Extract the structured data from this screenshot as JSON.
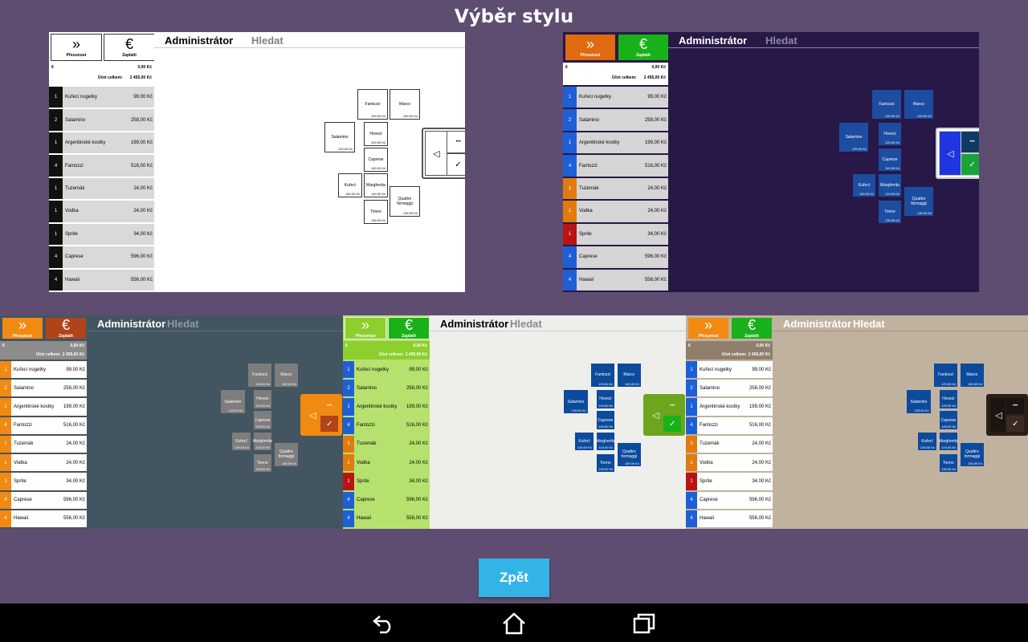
{
  "screen": {
    "title": "Výběr stylu",
    "back_label": "Zpět"
  },
  "pos": {
    "btn_next_label": "Přesunout",
    "btn_pay_label": "Zaplatit",
    "btn_pay_symbol": "€",
    "summary_count": "6",
    "summary_amount": "0,00 Kč",
    "summary_total_label": "Účet celkem:",
    "summary_total": "2 455,00 Kč",
    "user": "Administrátor",
    "search": "Hledat",
    "items": [
      {
        "q": "1",
        "name": "Kuřecí nugetky",
        "price": "99,00 Kč"
      },
      {
        "q": "2",
        "name": "Salamino",
        "price": "258,00 Kč"
      },
      {
        "q": "1",
        "name": "Argentinské kostky",
        "price": "199,00 Kč"
      },
      {
        "q": "4",
        "name": "Fantozzi",
        "price": "516,00 Kč"
      },
      {
        "q": "1",
        "name": "Tuzemák",
        "price": "24,00 Kč"
      },
      {
        "q": "1",
        "name": "Vodka",
        "price": "24,00 Kč"
      },
      {
        "q": "1",
        "name": "Sprite",
        "price": "34,00 Kč"
      },
      {
        "q": "4",
        "name": "Caprese",
        "price": "596,00 Kč"
      },
      {
        "q": "4",
        "name": "Hawaii",
        "price": "556,00 Kč"
      }
    ],
    "products": [
      {
        "name": "Fantozzi",
        "price": "129,00 Kč"
      },
      {
        "name": "Marco",
        "price": "149,00 Kč"
      },
      {
        "name": "Salamino",
        "price": "129,00 Kč"
      },
      {
        "name": "Hovezi",
        "price": "129,00 Kč"
      },
      {
        "name": "Caprese",
        "price": "149,00 Kč"
      },
      {
        "name": "Kuřecí",
        "price": "149,00 Kč"
      },
      {
        "name": "Margherita",
        "price": "119,00 Kč"
      },
      {
        "name": "Tonno",
        "price": "139,00 Kč"
      },
      {
        "name": "Quattro formaggi",
        "price": "139,00 Kč"
      }
    ],
    "ctrl": {
      "back_symbol": "◁",
      "more_symbol": "•••",
      "ok_symbol": "✓"
    }
  },
  "themes": [
    {
      "name": "white",
      "bg": "#ffffff",
      "left_bg": "#ffffff",
      "row_bg": "#d9d9d9",
      "row_text": "#000000",
      "qty_colors": [
        "#111111",
        "#111111",
        "#111111",
        "#111111",
        "#111111",
        "#111111",
        "#111111",
        "#111111",
        "#111111"
      ],
      "qty_text": "#ffffff",
      "btn_next_bg": "#ffffff",
      "btn_pay_bg": "#ffffff",
      "btn_border": "#333333",
      "btn_text": "#000000",
      "sum_bg": "#ffffff",
      "sum_text": "#000000",
      "hdr_text": "#000000",
      "search_text": "#808080",
      "hdr_line": "#cccccc",
      "prod_bg": "#ffffff",
      "prod_text": "#000000",
      "prod_border": "#333333",
      "ctrl_bg": "#ffffff",
      "ctrl_border": "#555555",
      "back_bg": "#ffffff",
      "back_text": "#000000",
      "more_bg": "#ffffff",
      "ok_bg": "#ffffff",
      "ok_text": "#000000"
    },
    {
      "name": "purple",
      "bg": "#281847",
      "left_bg": "#281847",
      "row_bg": "#d5d5d5",
      "row_text": "#000000",
      "qty_colors": [
        "#1f5fd6",
        "#1f5fd6",
        "#1f5fd6",
        "#1f5fd6",
        "#e07b10",
        "#e07b10",
        "#b81414",
        "#1f5fd6",
        "#1f5fd6"
      ],
      "qty_text": "#ffffff",
      "btn_next_bg": "#e06a10",
      "btn_pay_bg": "#19b119",
      "btn_border": "#281847",
      "btn_text": "#ffffff",
      "sum_bg": "#ffffff",
      "sum_text": "#000000",
      "hdr_text": "#ffffff",
      "search_text": "#8d86a6",
      "hdr_line": "#8d86a6",
      "prod_bg": "#1c4da1",
      "prod_text": "#ffffff",
      "prod_border": "#281847",
      "ctrl_bg": "#ffffff",
      "ctrl_border": "#cccccc",
      "back_bg": "#1f35e0",
      "back_text": "#ffffff",
      "more_bg": "#0e3b66",
      "ok_bg": "#1aa33a",
      "ok_text": "#ffffff"
    },
    {
      "name": "slate",
      "bg": "#435560",
      "left_bg": "#435560",
      "row_bg": "#ffffff",
      "row_text": "#000000",
      "qty_colors": [
        "#f08a12",
        "#f08a12",
        "#f08a12",
        "#f08a12",
        "#f08a12",
        "#f08a12",
        "#f08a12",
        "#f08a12",
        "#f08a12"
      ],
      "qty_text": "#ffffff",
      "btn_next_bg": "#f08a12",
      "btn_pay_bg": "#b04418",
      "btn_border": "#435560",
      "btn_text": "#ffffff",
      "sum_bg": "#8c8c8c",
      "sum_text": "#ffffff",
      "hdr_text": "#ffffff",
      "search_text": "#8e9aa2",
      "hdr_line": "#5e6d77",
      "prod_bg": "#7d7d7d",
      "prod_text": "#ffffff",
      "prod_border": "#435560",
      "ctrl_bg": "#f08a12",
      "ctrl_border": "#f08a12",
      "back_bg": "#f08a12",
      "back_text": "#ffffff",
      "more_bg": "#f08a12",
      "ok_bg": "#b04418",
      "ok_text": "#ffffff"
    },
    {
      "name": "lime",
      "bg": "#eeeeea",
      "left_bg": "#b7e16e",
      "row_bg": "#b7e16e",
      "row_text": "#000000",
      "qty_colors": [
        "#1f5fd6",
        "#1f5fd6",
        "#1f5fd6",
        "#1f5fd6",
        "#e07b10",
        "#e07b10",
        "#b81414",
        "#1f5fd6",
        "#1f5fd6"
      ],
      "qty_text": "#ffffff",
      "btn_next_bg": "#8ccf2e",
      "btn_pay_bg": "#19b119",
      "btn_border": "#eeeeea",
      "btn_text": "#ffffff",
      "sum_bg": "#8ccf2e",
      "sum_text": "#ffffff",
      "hdr_text": "#000000",
      "search_text": "#8a8a8a",
      "hdr_line": "#cfcfcf",
      "prod_bg": "#0c4a9c",
      "prod_text": "#ffffff",
      "prod_border": "#eeeeea",
      "ctrl_bg": "#6ca51e",
      "ctrl_border": "#6ca51e",
      "back_bg": "#6ca51e",
      "back_text": "#ffffff",
      "more_bg": "#6ca51e",
      "ok_bg": "#19b119",
      "ok_text": "#ffffff"
    },
    {
      "name": "beige",
      "bg": "#c1b2a0",
      "left_bg": "#c1b2a0",
      "row_bg": "#ffffff",
      "row_text": "#000000",
      "qty_colors": [
        "#1f5fd6",
        "#1f5fd6",
        "#1f5fd6",
        "#1f5fd6",
        "#e07b10",
        "#e07b10",
        "#b81414",
        "#1f5fd6",
        "#1f5fd6"
      ],
      "qty_text": "#ffffff",
      "btn_next_bg": "#f08a12",
      "btn_pay_bg": "#19b119",
      "btn_border": "#c1b2a0",
      "btn_text": "#ffffff",
      "sum_bg": "#907f6d",
      "sum_text": "#ffffff",
      "hdr_text": "#ffffff",
      "search_text": "#ffffff",
      "hdr_line": "#a39581",
      "prod_bg": "#0c4a9c",
      "prod_text": "#ffffff",
      "prod_border": "#c1b2a0",
      "ctrl_bg": "#2a1f18",
      "ctrl_border": "#2a1f18",
      "back_bg": "#1b1410",
      "back_text": "#ffffff",
      "more_bg": "#1b1410",
      "ok_bg": "#3a2a20",
      "ok_text": "#ffffff"
    }
  ],
  "nav": {
    "back_icon": "back-arrow-icon",
    "home_icon": "home-icon",
    "recents_icon": "recents-icon"
  }
}
